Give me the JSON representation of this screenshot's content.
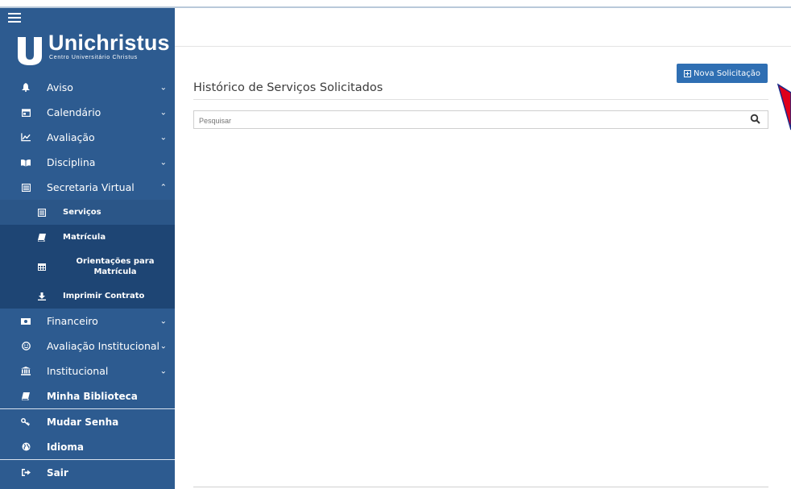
{
  "logo": {
    "name": "Unichristus",
    "subtitle": "Centro Universitário Christus"
  },
  "sidebar": {
    "items": [
      {
        "label": "Aviso",
        "icon": "bell-icon"
      },
      {
        "label": "Calendário",
        "icon": "calendar-icon"
      },
      {
        "label": "Avaliação",
        "icon": "chart-line-icon"
      },
      {
        "label": "Disciplina",
        "icon": "book-open-icon"
      },
      {
        "label": "Secretaria Virtual",
        "icon": "list-icon"
      }
    ],
    "sub_items": [
      {
        "label": "Serviços",
        "icon": "list-icon"
      },
      {
        "label": "Matrícula",
        "icon": "book-icon"
      },
      {
        "label": "Orientações para Matrícula",
        "icon": "calendar-grid-icon"
      },
      {
        "label": "Imprimir Contrato",
        "icon": "download-icon"
      }
    ],
    "items_after": [
      {
        "label": "Financeiro",
        "icon": "money-icon"
      },
      {
        "label": "Avaliação Institucional",
        "icon": "smile-icon"
      },
      {
        "label": "Institucional",
        "icon": "institution-icon"
      }
    ],
    "library": {
      "label": "Minha Biblioteca",
      "icon": "book-icon"
    },
    "account": [
      {
        "label": "Mudar Senha",
        "icon": "key-icon"
      },
      {
        "label": "Idioma",
        "icon": "globe-icon"
      }
    ],
    "logout": {
      "label": "Sair",
      "icon": "sign-out-icon"
    }
  },
  "main": {
    "title": "Histórico de Serviços Solicitados",
    "new_button": "Nova Solicitação",
    "search_placeholder": "Pesquisar"
  },
  "colors": {
    "sidebar": "#2d5b90",
    "submenu": "#1e4574",
    "button": "#2f6fb3",
    "arrow": "#e0001a"
  }
}
